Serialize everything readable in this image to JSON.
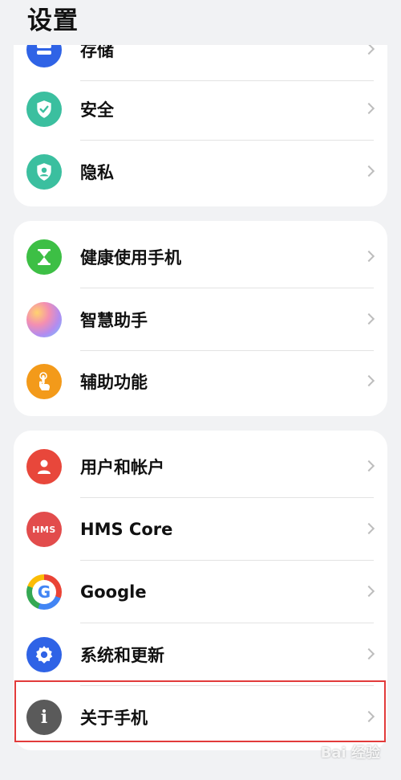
{
  "page": {
    "title": "设置"
  },
  "groups": [
    {
      "items": [
        {
          "label": "存储",
          "icon": "storage-icon",
          "color": "#2f63e6"
        },
        {
          "label": "安全",
          "icon": "shield-check-icon",
          "color": "#3bbf9f"
        },
        {
          "label": "隐私",
          "icon": "privacy-icon",
          "color": "#3bbf9f"
        }
      ]
    },
    {
      "items": [
        {
          "label": "健康使用手机",
          "icon": "hourglass-icon",
          "color": "#3dbf45"
        },
        {
          "label": "智慧助手",
          "icon": "smart-assistant-icon",
          "color": "#b28cf0"
        },
        {
          "label": "辅助功能",
          "icon": "hand-pointer-icon",
          "color": "#f39a1a"
        }
      ]
    },
    {
      "items": [
        {
          "label": "用户和帐户",
          "icon": "user-icon",
          "color": "#e8473b"
        },
        {
          "label": "HMS Core",
          "icon": "hms-icon",
          "icon_text": "HMS",
          "color": "#e24c4c"
        },
        {
          "label": "Google",
          "icon": "google-icon",
          "icon_text": "G",
          "color": "#ffffff"
        },
        {
          "label": "系统和更新",
          "icon": "gear-icon",
          "color": "#2f63e6"
        },
        {
          "label": "关于手机",
          "icon": "info-icon",
          "icon_text": "i",
          "color": "#5a5a5a"
        }
      ]
    }
  ],
  "watermark": "Bai 经验"
}
